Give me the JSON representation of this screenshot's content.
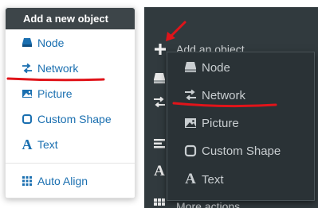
{
  "light_menu": {
    "header": "Add a new object",
    "items": [
      {
        "label": "Node",
        "icon": "node-icon"
      },
      {
        "label": "Network",
        "icon": "network-icon"
      },
      {
        "label": "Picture",
        "icon": "picture-icon"
      },
      {
        "label": "Custom Shape",
        "icon": "custom-shape-icon"
      },
      {
        "label": "Text",
        "icon": "text-icon"
      }
    ],
    "extra_items": [
      {
        "label": "Auto Align",
        "icon": "auto-align-icon"
      }
    ]
  },
  "dark_panel": {
    "add_object_label": "Add an object",
    "more_actions_label": "More actions",
    "submenu_items": [
      {
        "label": "Node",
        "icon": "node-icon"
      },
      {
        "label": "Network",
        "icon": "network-icon"
      },
      {
        "label": "Picture",
        "icon": "picture-icon"
      },
      {
        "label": "Custom Shape",
        "icon": "custom-shape-icon"
      },
      {
        "label": "Text",
        "icon": "text-icon"
      }
    ]
  },
  "colors": {
    "annotation": "#e0141a",
    "link_blue": "#1a6fb0",
    "dark_bg": "#313a3e",
    "header_bg": "#3d4549"
  }
}
